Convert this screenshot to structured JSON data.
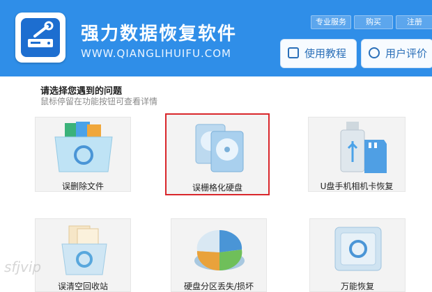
{
  "header": {
    "title": "强力数据恢复软件",
    "url": "WWW.QIANGLIHUIFU.COM",
    "top_links": [
      "专业服务",
      "购买",
      "注册"
    ],
    "buttons": [
      {
        "label": "使用教程",
        "icon": "document-icon"
      },
      {
        "label": "用户评价",
        "icon": "comment-icon"
      }
    ]
  },
  "main": {
    "prompt": "请选择您遇到的问题",
    "hint": "鼠标停留在功能按钮可查看详情",
    "tiles": [
      {
        "label": "误删除文件",
        "icon": "folder-recover-icon"
      },
      {
        "label": "误栅格化硬盘",
        "icon": "hard-disk-icon",
        "selected": true
      },
      {
        "label": "U盘手机相机卡恢复",
        "icon": "usb-sdcard-icon"
      },
      {
        "label": "误清空回收站",
        "icon": "recycle-bin-icon"
      },
      {
        "label": "硬盘分区丢失/损坏",
        "icon": "partition-pie-icon"
      },
      {
        "label": "万能恢复",
        "icon": "safe-icon"
      }
    ]
  },
  "watermark": "sfjvip",
  "colors": {
    "header": "#2f8ee8",
    "selected_border": "#d9262b",
    "button_text": "#2a6fb8"
  }
}
